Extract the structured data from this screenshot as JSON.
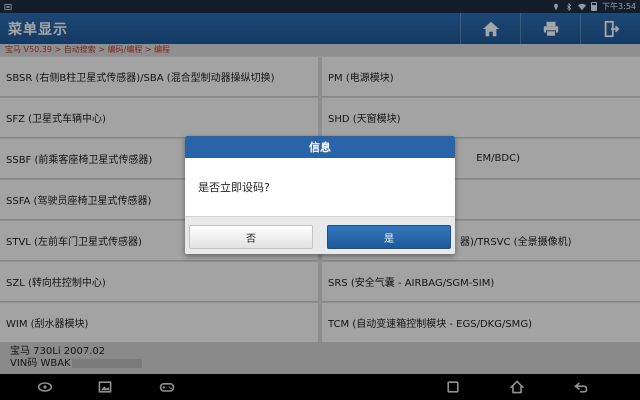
{
  "status_bar": {
    "time": "下午3:54",
    "icons": [
      "notification-icon",
      "location-icon",
      "bluetooth-icon",
      "wifi-icon",
      "battery-icon"
    ]
  },
  "header": {
    "title": "菜单显示",
    "buttons": [
      "home-icon",
      "print-icon",
      "exit-icon"
    ]
  },
  "breadcrumb": "宝马 V50.39 > 自动搜索 > 编码/编程 > 编程",
  "menu_items": [
    "SBSR (右侧B柱卫星式传感器)/SBA (混合型制动器操纵切换)",
    "PM (电源模块)",
    "SFZ (卫星式车辆中心)",
    "SHD (天窗模块)",
    "SSBF (前乘客座椅卫星式传感器)",
    "EM/BDC)",
    "SSFA (驾驶员座椅卫星式传感器)",
    "",
    "STVL (左前车门卫星式传感器)",
    "器)/TRSVC (全景摄像机)",
    "SZL (转向柱控制中心)",
    "SRS (安全气囊 - AIRBAG/SGM-SIM)",
    "WIM (刮水器模块)",
    "TCM (自动变速箱控制模块 - EGS/DKG/SMG)"
  ],
  "footer": {
    "vehicle": "宝马 730Li 2007.02",
    "vin_label": "VIN码 WBAK"
  },
  "dialog": {
    "title": "信息",
    "message": "是否立即设码?",
    "no_label": "否",
    "yes_label": "是"
  },
  "nav_bar": [
    "app-logo-icon",
    "gallery-icon",
    "gamepad-icon",
    "recent-apps-icon",
    "home-icon",
    "back-icon"
  ]
}
